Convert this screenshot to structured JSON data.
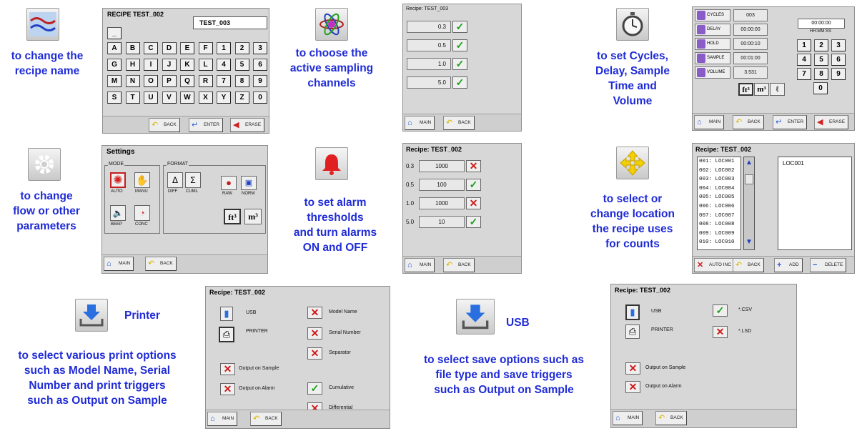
{
  "colors": {
    "caption": "#1f2bd6",
    "panel_bg": "#d7d7d7",
    "check_green": "#18a018",
    "cross_red": "#d01818",
    "nav_blue": "#2a5bd6"
  },
  "captions": {
    "recipe_name": [
      "to change the",
      "recipe name"
    ],
    "channels": [
      "to choose the",
      "active sampling",
      "channels"
    ],
    "cycles": [
      "to set Cycles,",
      "Delay, Sample",
      "Time and",
      "Volume"
    ],
    "settings": [
      "to change",
      "flow or other",
      "parameters"
    ],
    "alarm": [
      "to set alarm",
      "thresholds",
      "and turn alarms",
      "ON and OFF"
    ],
    "location": [
      "to select or",
      "change location",
      "the recipe uses",
      "for counts"
    ],
    "printer_label": "Printer",
    "printer_desc": [
      "to select various print options",
      "such as Model Name, Serial",
      "Number and print triggers",
      "such as Output on Sample"
    ],
    "usb_label": "USB",
    "usb_desc": [
      "to select save options such as",
      "file type and save triggers",
      "such as Output on Sample"
    ]
  },
  "icons": {
    "recipe_name": "wave-icon",
    "channels": "atom-icon",
    "cycles": "stopwatch-icon",
    "settings": "gear-icon",
    "alarm": "bell-icon",
    "location": "move-arrows-icon",
    "printer": "download-tray-icon",
    "usb": "download-tray-icon"
  },
  "nav": {
    "main": "MAIN",
    "back": "BACK",
    "enter": "ENTER",
    "erase": "ERASE",
    "add": "ADD",
    "delete": "DELETE",
    "auto_inc": "AUTO INC"
  },
  "keyboard_panel": {
    "title": "RECIPE TEST_002",
    "input_value": "TEST_003",
    "shift_key": "_",
    "rows": [
      [
        "A",
        "B",
        "C",
        "D",
        "E",
        "F",
        "1",
        "2",
        "3"
      ],
      [
        "G",
        "H",
        "I",
        "J",
        "K",
        "L",
        "4",
        "5",
        "6"
      ],
      [
        "M",
        "N",
        "O",
        "P",
        "Q",
        "R",
        "7",
        "8",
        "9"
      ],
      [
        "S",
        "T",
        "U",
        "V",
        "W",
        "X",
        "Y",
        "Z",
        "0"
      ]
    ]
  },
  "channels_panel": {
    "title": "Recipe:  TEST_003",
    "channels": [
      {
        "size": "0.3",
        "state": "on"
      },
      {
        "size": "0.5",
        "state": "on"
      },
      {
        "size": "1.0",
        "state": "on"
      },
      {
        "size": "5.0",
        "state": "on"
      }
    ]
  },
  "cycles_panel": {
    "rows": [
      {
        "label": "CYCLES",
        "value": "003"
      },
      {
        "label": "DELAY",
        "value": "00:00:00"
      },
      {
        "label": "HOLD",
        "value": "00:00:10"
      },
      {
        "label": "SAMPLE",
        "value": "00:01:00"
      },
      {
        "label": "VOLUME",
        "value": "3.531"
      }
    ],
    "time_value": "00:00:00",
    "time_format": "HH:MM:SS",
    "keypad": [
      [
        "1",
        "2",
        "3"
      ],
      [
        "4",
        "5",
        "6"
      ],
      [
        "7",
        "8",
        "9"
      ],
      [
        "0"
      ]
    ],
    "units": [
      "ft³",
      "m³",
      "ℓ"
    ]
  },
  "settings_panel": {
    "title": "Settings",
    "mode_legend": "MODE",
    "format_legend": "FORMAT",
    "mode_buttons": [
      "AUTO",
      "MANU",
      "BEEP",
      "CONC"
    ],
    "format_buttons": [
      "DIFF",
      "CUML",
      "RAW",
      "NORM"
    ],
    "format_glyphs": [
      "Δ",
      "Σ"
    ],
    "units": [
      "ft³",
      "m³"
    ]
  },
  "alarm_panel": {
    "title": "Recipe: TEST_002",
    "rows": [
      {
        "size": "0.3",
        "threshold": "1000",
        "state": "off"
      },
      {
        "size": "0.5",
        "threshold": "100",
        "state": "on"
      },
      {
        "size": "1.0",
        "threshold": "1000",
        "state": "off"
      },
      {
        "size": "5.0",
        "threshold": "10",
        "state": "on"
      }
    ]
  },
  "location_panel": {
    "title": "Recipe: TEST_002",
    "locations": [
      "001:  LOC001",
      "002:  LOC002",
      "003:  LOC003",
      "004:  LOC004",
      "005:  LOC005",
      "006:  LOC006",
      "007:  LOC007",
      "008:  LOC008",
      "009:  LOC009",
      "010:  LOC010"
    ],
    "selected": "LOC001"
  },
  "printer_panel": {
    "title": "Recipe: TEST_002",
    "usb": "USB",
    "printer": "PRINTER",
    "options_left": [
      {
        "label": "Output on Sample",
        "state": "off"
      },
      {
        "label": "Output on Alarm",
        "state": "off"
      }
    ],
    "options_right": [
      {
        "label": "Model Name",
        "state": "off"
      },
      {
        "label": "Serial Number",
        "state": "off"
      },
      {
        "label": "Separator",
        "state": "off"
      },
      {
        "label": "Cumulative",
        "state": "on"
      },
      {
        "label": "Differential",
        "state": "off"
      }
    ]
  },
  "usb_panel": {
    "title": "Recipe: TEST_002",
    "usb": "USB",
    "printer": "PRINTER",
    "file_types": [
      {
        "label": "*.CSV",
        "state": "on"
      },
      {
        "label": "*.LSD",
        "state": "off"
      }
    ],
    "options": [
      {
        "label": "Output on Sample",
        "state": "off"
      },
      {
        "label": "Output on Alarm",
        "state": "off"
      }
    ]
  }
}
